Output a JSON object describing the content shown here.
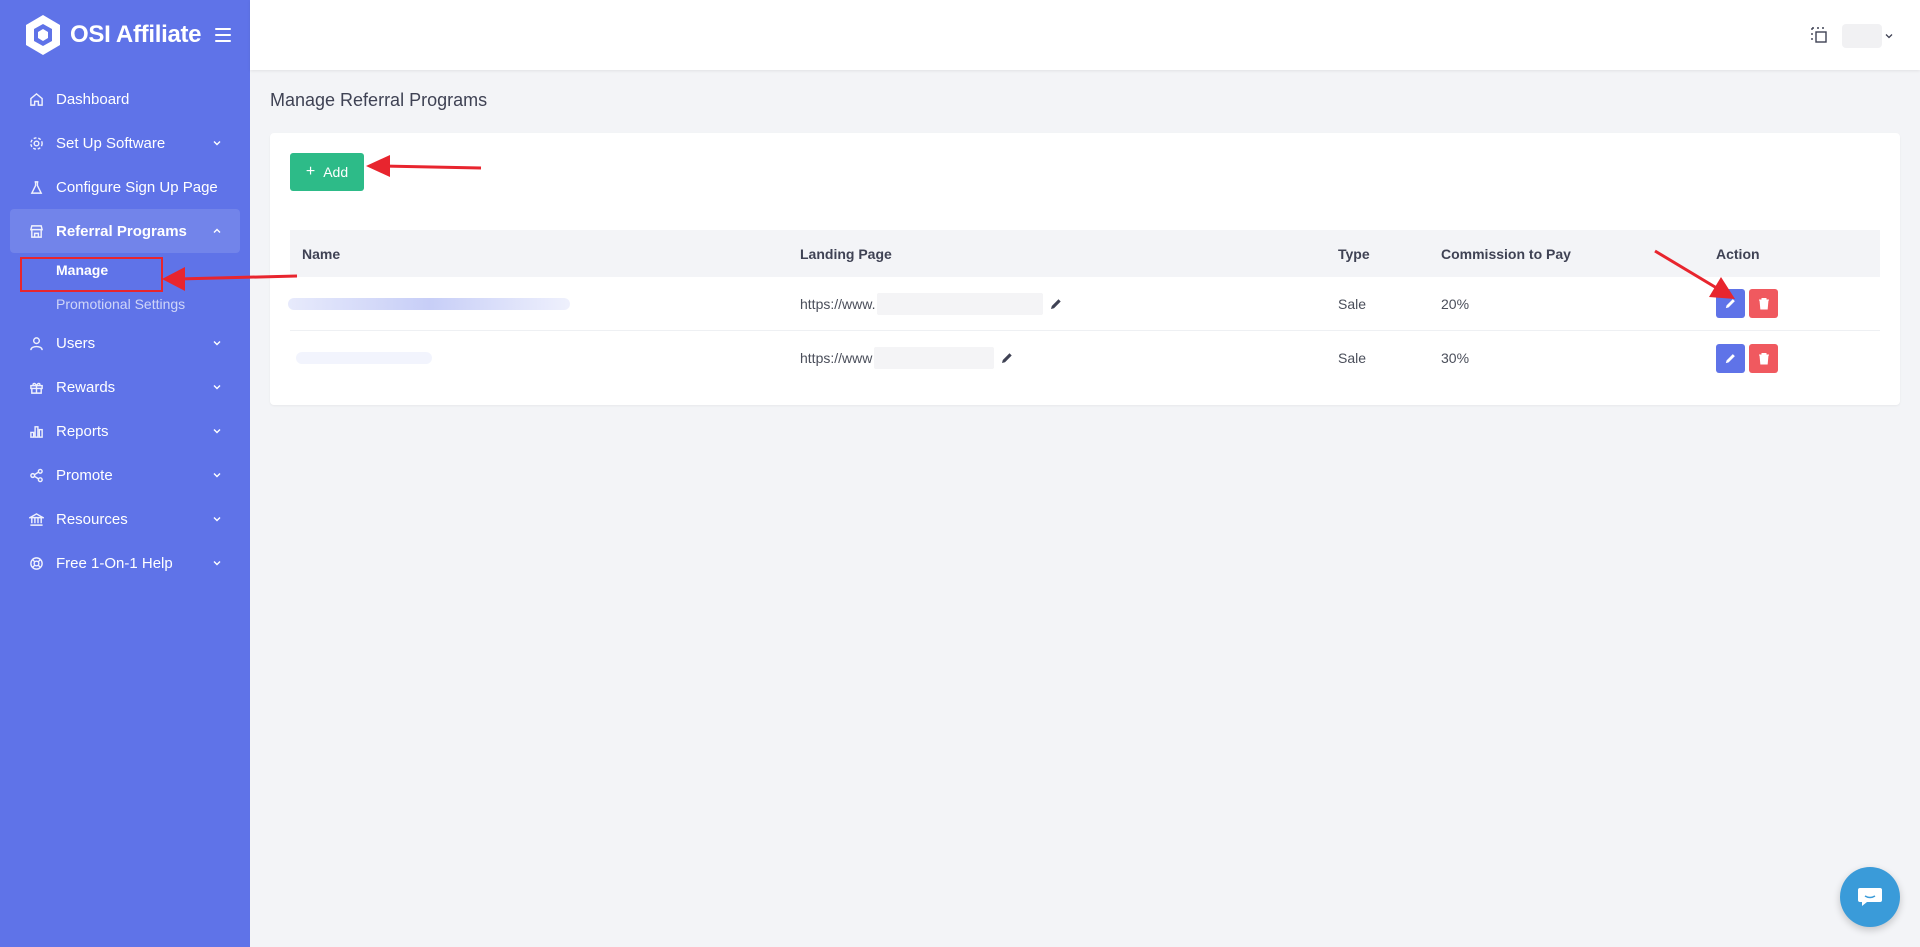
{
  "brand": {
    "name": "OSI Affiliate"
  },
  "sidebar": {
    "items": [
      {
        "label": "Dashboard",
        "icon": "home-icon",
        "has_chevron": false
      },
      {
        "label": "Set Up Software",
        "icon": "gear-icon",
        "has_chevron": true
      },
      {
        "label": "Configure Sign Up Page",
        "icon": "flask-icon",
        "has_chevron": false
      },
      {
        "label": "Referral Programs",
        "icon": "store-icon",
        "has_chevron": true,
        "expanded": true,
        "active": true,
        "children": [
          {
            "label": "Manage",
            "current": true
          },
          {
            "label": "Promotional Settings",
            "current": false
          }
        ]
      },
      {
        "label": "Users",
        "icon": "user-icon",
        "has_chevron": true
      },
      {
        "label": "Rewards",
        "icon": "gift-icon",
        "has_chevron": true
      },
      {
        "label": "Reports",
        "icon": "bar-chart-icon",
        "has_chevron": true
      },
      {
        "label": "Promote",
        "icon": "share-icon",
        "has_chevron": true
      },
      {
        "label": "Resources",
        "icon": "bank-icon",
        "has_chevron": true
      },
      {
        "label": "Free 1-On-1 Help",
        "icon": "lifebuoy-icon",
        "has_chevron": true
      }
    ]
  },
  "page": {
    "title": "Manage Referral Programs"
  },
  "toolbar": {
    "add_label": "Add"
  },
  "table": {
    "columns": [
      "Name",
      "Landing Page",
      "Type",
      "Commission to Pay",
      "Action"
    ],
    "rows": [
      {
        "landing_prefix": "https://www.",
        "type": "Sale",
        "commission": "20%"
      },
      {
        "landing_prefix": "https://www",
        "type": "Sale",
        "commission": "30%"
      }
    ]
  },
  "colors": {
    "sidebar": "#5f73e8",
    "add_button": "#2dbb88",
    "edit_button": "#5f73e8",
    "delete_button": "#f0595f",
    "annotation": "#e8252e",
    "chat_button": "#3a9bd9"
  }
}
